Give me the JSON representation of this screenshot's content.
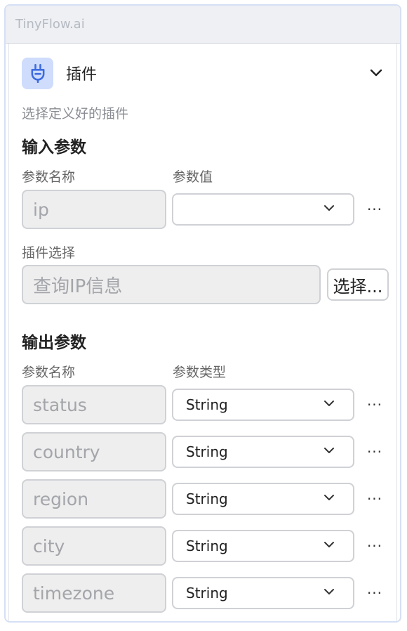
{
  "header": {
    "brand": "TinyFlow.ai"
  },
  "node": {
    "icon": "plug-icon",
    "title": "插件",
    "description": "选择定义好的插件",
    "collapse_icon": "chevron-down-icon"
  },
  "input_params": {
    "section_title": "输入参数",
    "col_name": "参数名称",
    "col_value": "参数值",
    "rows": [
      {
        "name": "ip",
        "value": ""
      }
    ]
  },
  "plugin_select": {
    "label": "插件选择",
    "value": "查询IP信息",
    "button_label": "选择..."
  },
  "output_params": {
    "section_title": "输出参数",
    "col_name": "参数名称",
    "col_type": "参数类型",
    "rows": [
      {
        "name": "status",
        "type": "String"
      },
      {
        "name": "country",
        "type": "String"
      },
      {
        "name": "region",
        "type": "String"
      },
      {
        "name": "city",
        "type": "String"
      },
      {
        "name": "timezone",
        "type": "String"
      }
    ]
  },
  "colors": {
    "accent": "#3d6be0",
    "icon_bg": "#cfdcfb",
    "border": "#d6e0f5"
  },
  "more_label": "···"
}
